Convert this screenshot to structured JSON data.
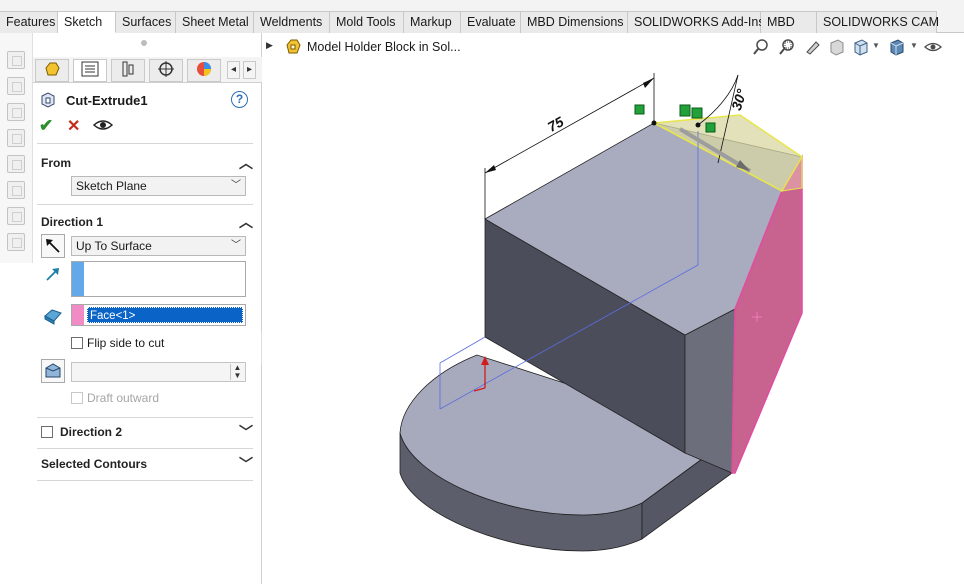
{
  "command_tabs": [
    {
      "label": "Features"
    },
    {
      "label": "Sketch"
    },
    {
      "label": "Surfaces"
    },
    {
      "label": "Sheet Metal"
    },
    {
      "label": "Weldments"
    },
    {
      "label": "Mold Tools"
    },
    {
      "label": "Markup"
    },
    {
      "label": "Evaluate"
    },
    {
      "label": "MBD Dimensions"
    },
    {
      "label": "SOLIDWORKS Add-Ins"
    },
    {
      "label": "MBD"
    },
    {
      "label": "SOLIDWORKS CAM"
    }
  ],
  "active_tab": "Sketch",
  "property_manager": {
    "title": "Cut-Extrude1",
    "help_label": "?",
    "ok_label": "✔",
    "cancel_label": "✕",
    "from": {
      "heading": "From",
      "start_condition": "Sketch Plane"
    },
    "direction1": {
      "heading": "Direction 1",
      "end_condition": "Up To Surface",
      "face_selection": "Face<1>",
      "flip_side_label": "Flip side to cut",
      "flip_side_checked": false,
      "draft_outward_label": "Draft outward",
      "draft_outward_checked": false
    },
    "direction2": {
      "heading": "Direction 2",
      "checked": false
    },
    "selected_contours": {
      "heading": "Selected Contours"
    }
  },
  "graphics": {
    "part_name": "Model Holder Block in Sol...",
    "dimensions": {
      "length": "75",
      "angle": "30°"
    }
  },
  "colors": {
    "selection_blue": "#0a64c8",
    "face_pink": "#e24ca0",
    "preview_yellow": "#e8e64a",
    "model_top": "#a9abbf",
    "model_side_dark": "#4d4f5c"
  }
}
